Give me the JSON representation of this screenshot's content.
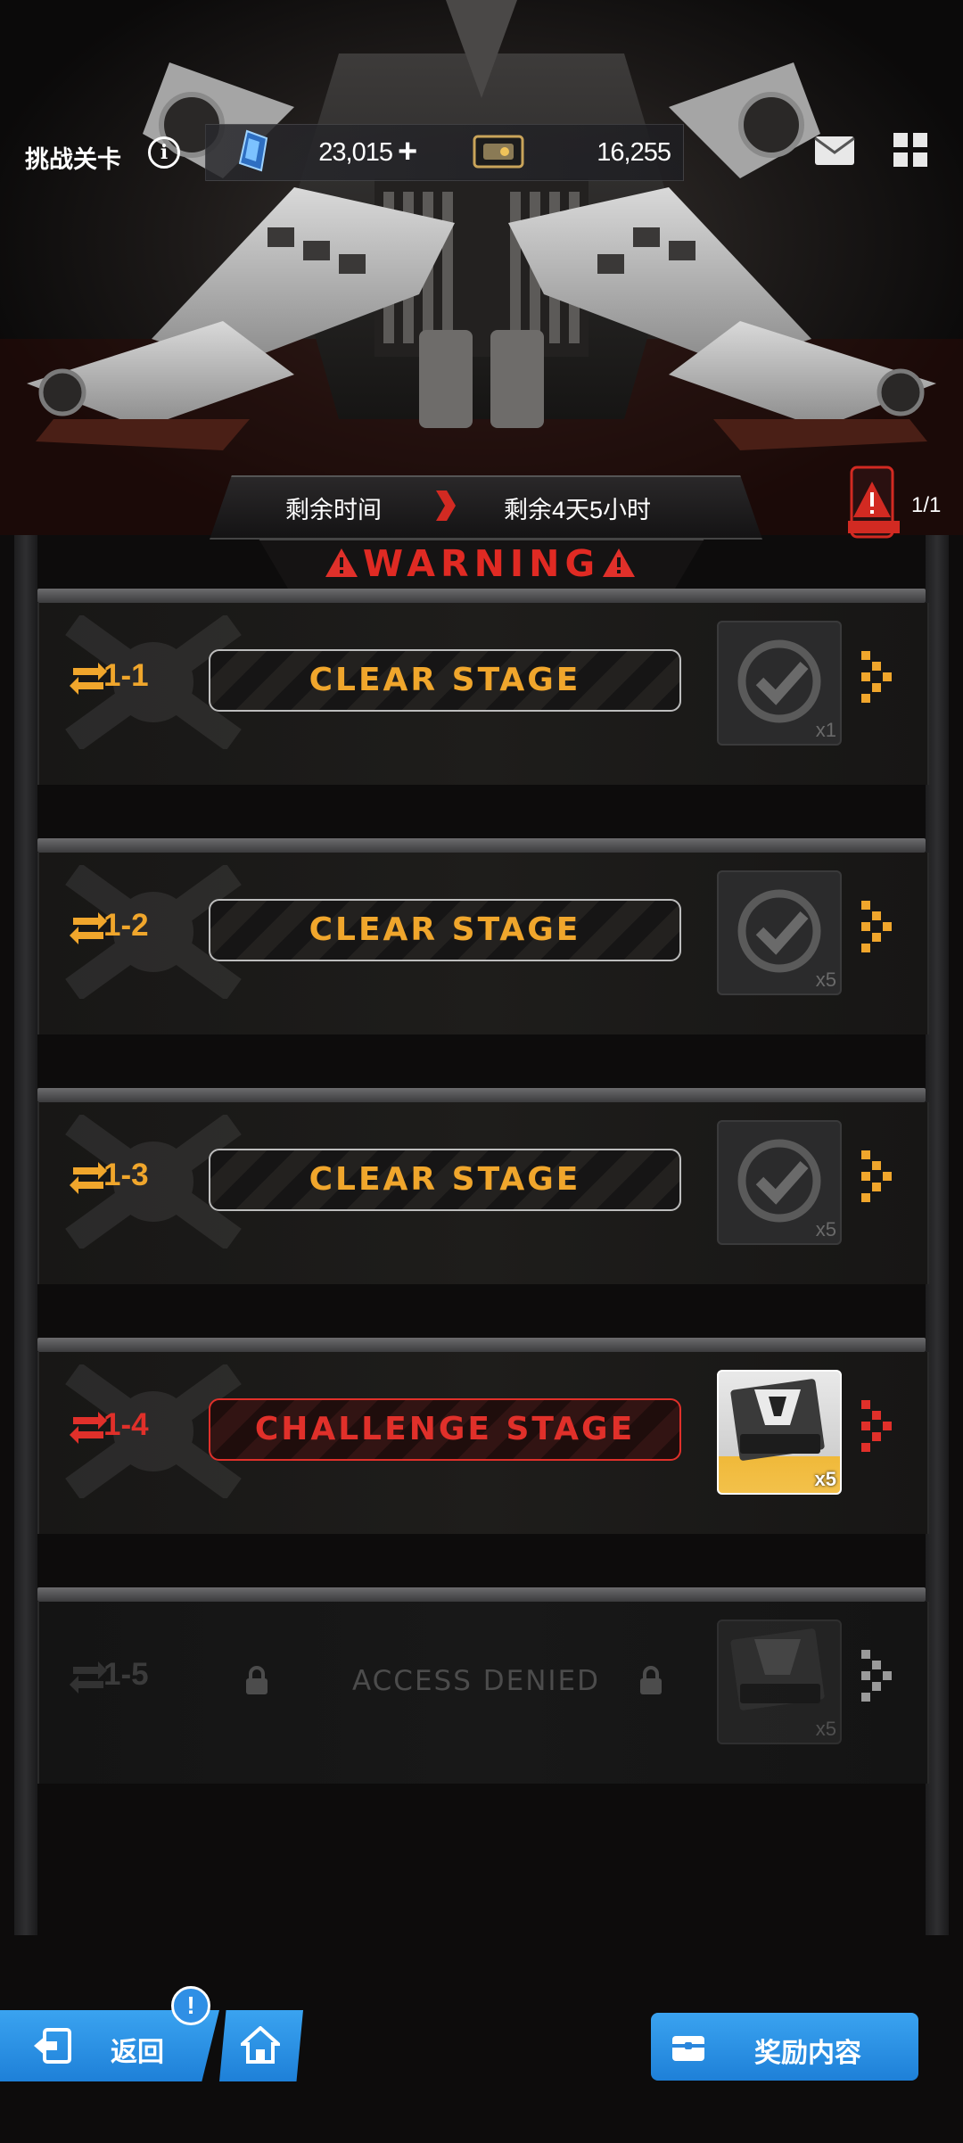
{
  "header": {
    "title": "挑战关卡",
    "crystal_count": "23,015",
    "card_count": "16,255"
  },
  "timer": {
    "label": "剩余时间",
    "value": "剩余4天5小时"
  },
  "danger": {
    "count": "1/1"
  },
  "warning": {
    "text": "WARNING"
  },
  "stages": [
    {
      "label": "1-1",
      "button": "CLEAR STAGE",
      "reward_qty": "x1",
      "state": "cleared"
    },
    {
      "label": "1-2",
      "button": "CLEAR STAGE",
      "reward_qty": "x5",
      "state": "cleared"
    },
    {
      "label": "1-3",
      "button": "CLEAR STAGE",
      "reward_qty": "x5",
      "state": "cleared"
    },
    {
      "label": "1-4",
      "button": "CHALLENGE STAGE",
      "reward_qty": "x5",
      "state": "active"
    },
    {
      "label": "1-5",
      "button": "ACCESS DENIED",
      "reward_qty": "x5",
      "state": "locked"
    }
  ],
  "footer": {
    "back_label": "返回",
    "badge": "!",
    "reward_label": "奖励内容"
  },
  "colors": {
    "accent_gold": "#f0a62c",
    "accent_red": "#e0302a",
    "button_blue": "#2f8fe5"
  }
}
